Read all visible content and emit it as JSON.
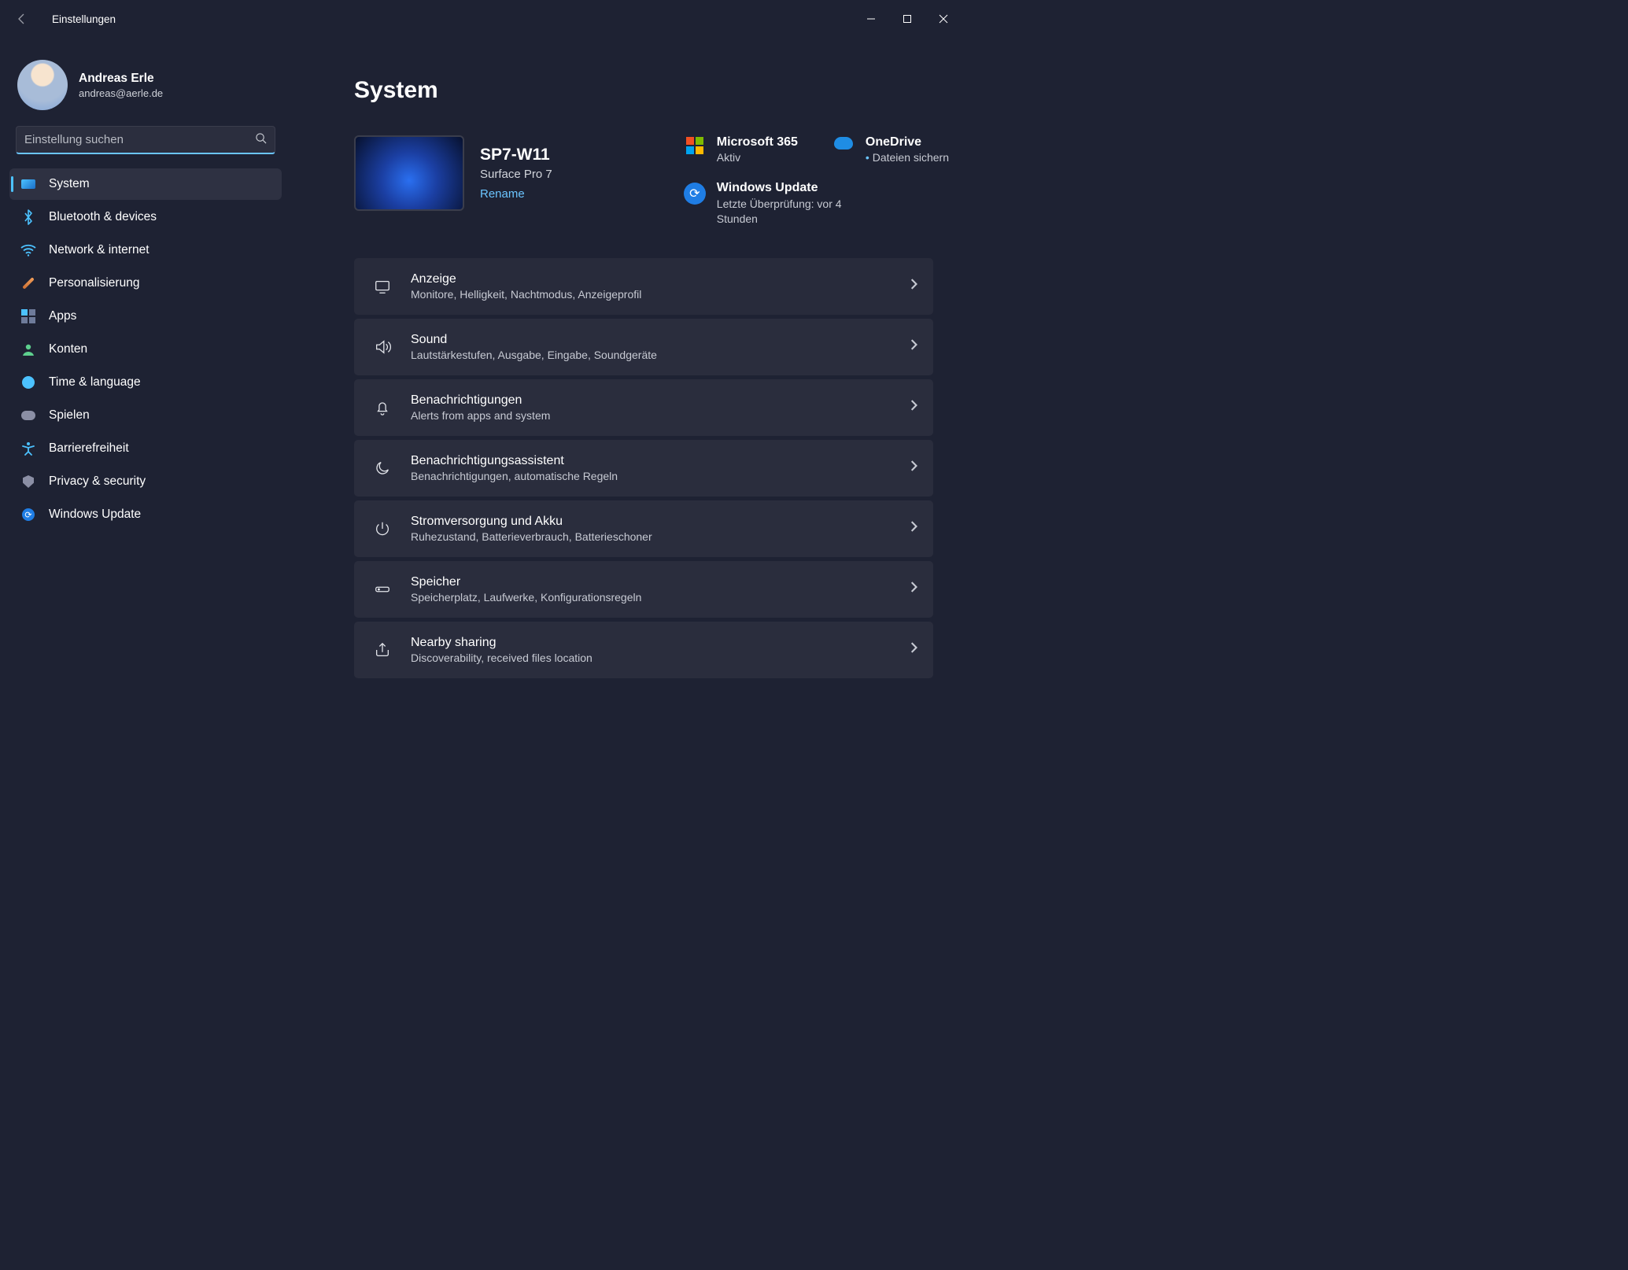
{
  "titlebar": {
    "title": "Einstellungen"
  },
  "profile": {
    "name": "Andreas Erle",
    "email": "andreas@aerle.de"
  },
  "search": {
    "placeholder": "Einstellung suchen"
  },
  "sidebar": {
    "items": [
      {
        "label": "System",
        "icon": "system",
        "active": true
      },
      {
        "label": "Bluetooth & devices",
        "icon": "bt",
        "active": false
      },
      {
        "label": "Network & internet",
        "icon": "wifi",
        "active": false
      },
      {
        "label": "Personalisierung",
        "icon": "brush",
        "active": false
      },
      {
        "label": "Apps",
        "icon": "apps",
        "active": false
      },
      {
        "label": "Konten",
        "icon": "user",
        "active": false
      },
      {
        "label": "Time & language",
        "icon": "clock",
        "active": false
      },
      {
        "label": "Spielen",
        "icon": "game",
        "active": false
      },
      {
        "label": "Barrierefreiheit",
        "icon": "access",
        "active": false
      },
      {
        "label": "Privacy & security",
        "icon": "shield",
        "active": false
      },
      {
        "label": "Windows Update",
        "icon": "update",
        "active": false
      }
    ]
  },
  "page": {
    "title": "System"
  },
  "device": {
    "name": "SP7-W11",
    "model": "Surface Pro 7",
    "rename_label": "Rename"
  },
  "status": {
    "ms365": {
      "title": "Microsoft 365",
      "sub": "Aktiv"
    },
    "onedrive": {
      "title": "OneDrive",
      "sub": "Dateien sichern"
    },
    "winupdate": {
      "title": "Windows Update",
      "sub": "Letzte Überprüfung: vor 4 Stunden"
    }
  },
  "settings": [
    {
      "id": "display",
      "title": "Anzeige",
      "sub": "Monitore, Helligkeit, Nachtmodus, Anzeigeprofil"
    },
    {
      "id": "sound",
      "title": "Sound",
      "sub": "Lautstärkestufen, Ausgabe, Eingabe, Soundgeräte"
    },
    {
      "id": "notif",
      "title": "Benachrichtigungen",
      "sub": "Alerts from apps and system"
    },
    {
      "id": "focus",
      "title": "Benachrichtigungsassistent",
      "sub": "Benachrichtigungen, automatische Regeln"
    },
    {
      "id": "power",
      "title": "Stromversorgung und Akku",
      "sub": "Ruhezustand, Batterieverbrauch, Batterieschoner"
    },
    {
      "id": "storage",
      "title": "Speicher",
      "sub": "Speicherplatz, Laufwerke, Konfigurationsregeln"
    },
    {
      "id": "nearby",
      "title": "Nearby sharing",
      "sub": "Discoverability, received files location"
    }
  ]
}
